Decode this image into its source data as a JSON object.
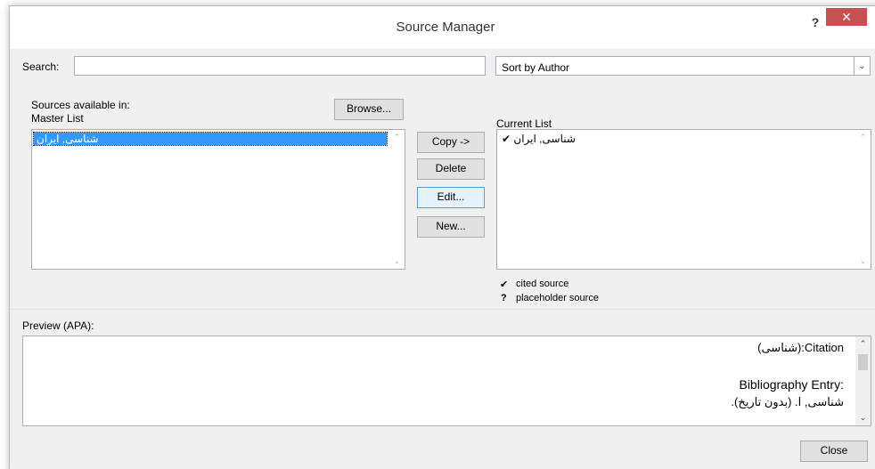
{
  "window": {
    "title": "Source Manager",
    "help_label": "?",
    "close_label": "✕"
  },
  "search": {
    "label": "Search:",
    "value": "",
    "placeholder": ""
  },
  "sort": {
    "selected": "Sort by Author",
    "arrow": "⌄"
  },
  "master": {
    "label_line1": "Sources available in:",
    "label_line2": "Master List",
    "browse_label": "Browse...",
    "items": [
      "شناسی, ایران"
    ]
  },
  "actions": {
    "copy_label": "Copy ->",
    "delete_label": "Delete",
    "edit_label": "Edit...",
    "new_label": "New..."
  },
  "current": {
    "label": "Current List",
    "items": [
      {
        "text": "شناسی, ایران",
        "mark": "✔"
      }
    ]
  },
  "legend": {
    "cited_mark": "✔",
    "cited_label": "cited source",
    "placeholder_mark": "?",
    "placeholder_label": "placeholder source"
  },
  "preview": {
    "label": "Preview (APA):",
    "citation": "Citation:(شناسی)",
    "bib_heading": "Bibliography Entry:",
    "bib_entry": "شناسی, ا. (بدون تاریخ)."
  },
  "footer": {
    "close_label": "Close"
  },
  "scroll": {
    "up": "⌃",
    "down": "⌄"
  }
}
